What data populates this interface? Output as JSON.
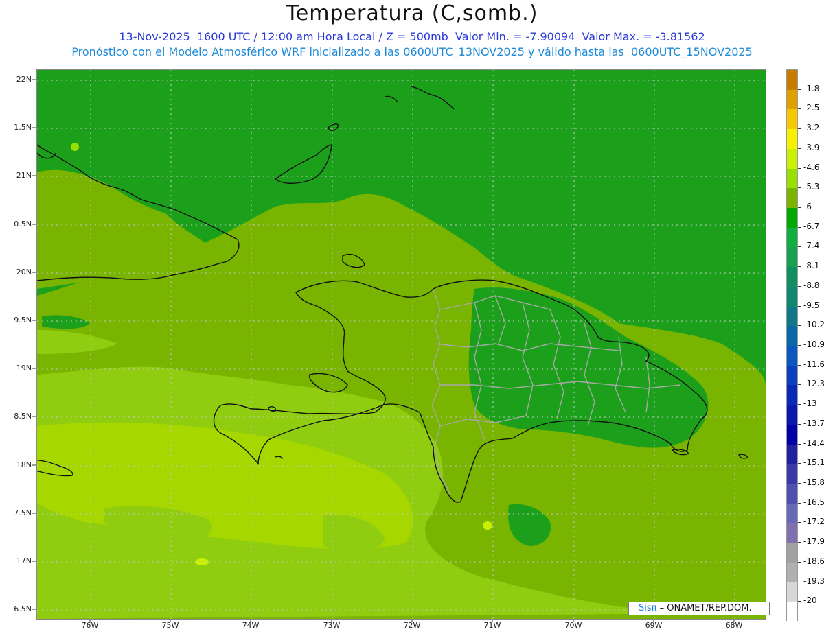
{
  "title": "Temperatura (C,somb.)",
  "subtitle1": "13-Nov-2025  1600 UTC / 12:00 am Hora Local / Z = 500mb  Valor Min. = -7.90094  Valor Max. = -3.81562",
  "subtitle2": "Pronóstico con el Modelo Atmosférico WRF inicializado a las 0600UTC_13NOV2025 y válido hasta las  0600UTC_15NOV2025",
  "lat_labels": [
    "22N",
    "1.5N",
    "21N",
    "0.5N",
    "20N",
    "9.5N",
    "19N",
    "8.5N",
    "18N",
    "7.5N",
    "17N",
    "6.5N"
  ],
  "lon_labels": [
    "76W",
    "75W",
    "74W",
    "73W",
    "72W",
    "71W",
    "70W",
    "69W",
    "68W"
  ],
  "map_extent": {
    "lon": [
      -76.65,
      -67.6
    ],
    "lat": [
      16.45,
      22.05
    ]
  },
  "colorbar": {
    "labels": [
      "-1.8",
      "-2.5",
      "-3.2",
      "-3.9",
      "-4.6",
      "-5.3",
      "-6",
      "-6.7",
      "-7.4",
      "-8.1",
      "-8.8",
      "-9.5",
      "-10.2",
      "-10.9",
      "-11.6",
      "-12.3",
      "-13",
      "-13.7",
      "-14.4",
      "-15.1",
      "-15.8",
      "-16.5",
      "-17.2",
      "-17.9",
      "-18.6",
      "-19.3",
      "-20"
    ],
    "colors": [
      "#c87c00",
      "#e0a000",
      "#f7c800",
      "#f7f000",
      "#c8f000",
      "#98e000",
      "#78b400",
      "#00aa00",
      "#10b040",
      "#18a050",
      "#109060",
      "#108870",
      "#107888",
      "#0a68a8",
      "#0a58c0",
      "#0a40c0",
      "#0828b8",
      "#0818b0",
      "#0000a8",
      "#2020a0",
      "#3838a8",
      "#5050b0",
      "#6868b8",
      "#8070b0",
      "#a0a0a0",
      "#b0b0b0",
      "#d8d8d8",
      "#ffffff"
    ]
  },
  "field_colors": {
    "shade_minus_6_7": "#1ca01c",
    "shade_minus_6": "#78b400",
    "shade_minus_5_3": "#90cc10",
    "shade_minus_4_6": "#a6d800",
    "shade_minus_7_4": "#12a83a",
    "coastline": "#111111",
    "provinces": "#a8a8a8",
    "grid": "#c8c8c8"
  },
  "credit": {
    "brand": "Sisπ",
    "text": "– ONAMET/REP.DOM."
  }
}
